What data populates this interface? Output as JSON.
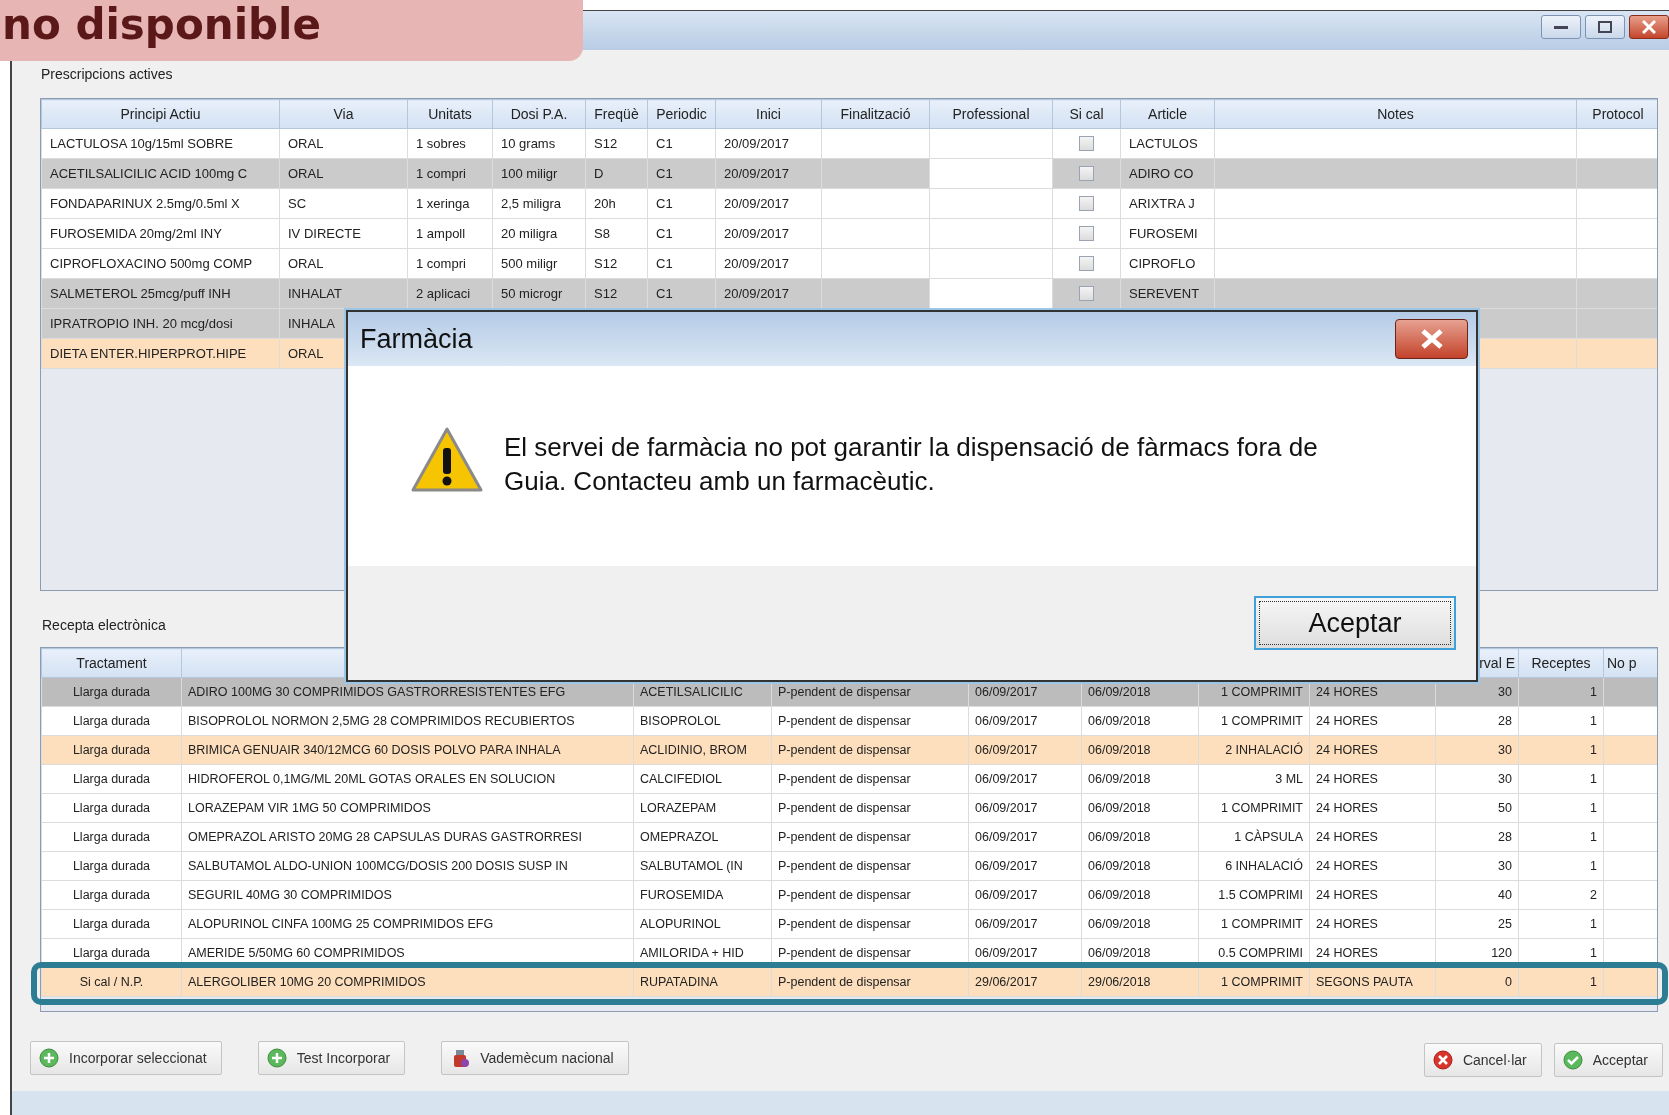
{
  "annotation_label": "no disponible",
  "prescriptions": {
    "title": "Prescripcions actives",
    "columns": [
      "Principi Actiu",
      "Via",
      "Unitats",
      "Dosi P.A.",
      "Freqüè",
      "Periodic",
      "Inici",
      "Finalització",
      "Professional",
      "Si cal",
      "Article",
      "Notes",
      "Protocol"
    ],
    "rows": [
      {
        "cells": [
          "LACTULOSA 10g/15ml SOBRE",
          "ORAL",
          "1 sobres",
          "10 grams",
          "S12",
          "C1",
          "20/09/2017"
        ],
        "si_cal": false,
        "article": "LACTULOS",
        "greyed": false,
        "highlighted": false
      },
      {
        "cells": [
          "ACETILSALICILIC ACID 100mg C",
          "ORAL",
          "1 compri",
          "100 miligr",
          "D",
          "C1",
          "20/09/2017"
        ],
        "si_cal": false,
        "article": "ADIRO CO",
        "greyed": true,
        "highlighted": false
      },
      {
        "cells": [
          "FONDAPARINUX 2.5mg/0.5ml X",
          "SC",
          "1 xeringa",
          "2,5 miligra",
          "20h",
          "C1",
          "20/09/2017"
        ],
        "si_cal": false,
        "article": "ARIXTRA J",
        "greyed": false,
        "highlighted": false
      },
      {
        "cells": [
          "FUROSEMIDA 20mg/2ml INY",
          "IV DIRECTE",
          "1 ampoll",
          "20 miligra",
          "S8",
          "C1",
          "20/09/2017"
        ],
        "si_cal": false,
        "article": "FUROSEMI",
        "greyed": false,
        "highlighted": false
      },
      {
        "cells": [
          "CIPROFLOXACINO 500mg COMP",
          "ORAL",
          "1 compri",
          "500 miligr",
          "S12",
          "C1",
          "20/09/2017"
        ],
        "si_cal": false,
        "article": "CIPROFLO",
        "greyed": false,
        "highlighted": false
      },
      {
        "cells": [
          "SALMETEROL 25mcg/puff INH",
          "INHALAT",
          "2 aplicaci",
          "50 microgr",
          "S12",
          "C1",
          "20/09/2017"
        ],
        "si_cal": false,
        "article": "SEREVENT",
        "greyed": true,
        "highlighted": false
      },
      {
        "cells": [
          "IPRATROPIO INH. 20 mcg/dosi",
          "INHALA"
        ],
        "greyed": true,
        "highlighted": false
      },
      {
        "cells": [
          "DIETA ENTER.HIPERPROT.HIPE",
          "ORAL"
        ],
        "greyed": false,
        "highlighted": true
      }
    ]
  },
  "prescription_e": {
    "title": "Recepta electrònica",
    "columns": [
      "Tractament",
      null,
      null,
      null,
      null,
      null,
      null,
      null,
      "rval E",
      "Receptes",
      "No p"
    ],
    "rows": [
      {
        "cells": [
          "Llarga durada",
          "ADIRO 100MG 30 COMPRIMIDOS GASTRORRESISTENTES EFG",
          "ACETILSALICILIC",
          "P-pendent de dispensar",
          "06/09/2017",
          "06/09/2018",
          "1 COMPRIMIT",
          "24 HORES",
          "30",
          "1"
        ],
        "greyed": true,
        "highlighted": false
      },
      {
        "cells": [
          "Llarga durada",
          "BISOPROLOL NORMON 2,5MG 28 COMPRIMIDOS RECUBIERTOS",
          "BISOPROLOL",
          "P-pendent de dispensar",
          "06/09/2017",
          "06/09/2018",
          "1 COMPRIMIT",
          "24 HORES",
          "28",
          "1"
        ],
        "greyed": false,
        "highlighted": false
      },
      {
        "cells": [
          "Llarga durada",
          "BRIMICA GENUAIR 340/12MCG 60 DOSIS POLVO PARA INHALA",
          "ACLIDINIO, BROM",
          "P-pendent de dispensar",
          "06/09/2017",
          "06/09/2018",
          "2 INHALACIÓ",
          "24 HORES",
          "30",
          "1"
        ],
        "greyed": false,
        "highlighted": true
      },
      {
        "cells": [
          "Llarga durada",
          "HIDROFEROL 0,1MG/ML 20ML GOTAS ORALES EN SOLUCION",
          "CALCIFEDIOL",
          "P-pendent de dispensar",
          "06/09/2017",
          "06/09/2018",
          "3 ML",
          "24 HORES",
          "30",
          "1"
        ],
        "greyed": false,
        "highlighted": false
      },
      {
        "cells": [
          "Llarga durada",
          "LORAZEPAM VIR 1MG 50 COMPRIMIDOS",
          "LORAZEPAM",
          "P-pendent de dispensar",
          "06/09/2017",
          "06/09/2018",
          "1 COMPRIMIT",
          "24 HORES",
          "50",
          "1"
        ],
        "greyed": false,
        "highlighted": false
      },
      {
        "cells": [
          "Llarga durada",
          "OMEPRAZOL ARISTO 20MG 28 CAPSULAS DURAS GASTRORRESI",
          "OMEPRAZOL",
          "P-pendent de dispensar",
          "06/09/2017",
          "06/09/2018",
          "1 CÀPSULA",
          "24 HORES",
          "28",
          "1"
        ],
        "greyed": false,
        "highlighted": false
      },
      {
        "cells": [
          "Llarga durada",
          "SALBUTAMOL ALDO-UNION 100MCG/DOSIS 200 DOSIS SUSP IN",
          "SALBUTAMOL (IN",
          "P-pendent de dispensar",
          "06/09/2017",
          "06/09/2018",
          "6 INHALACIÓ",
          "24 HORES",
          "30",
          "1"
        ],
        "greyed": false,
        "highlighted": false
      },
      {
        "cells": [
          "Llarga durada",
          "SEGURIL 40MG 30 COMPRIMIDOS",
          "FUROSEMIDA",
          "P-pendent de dispensar",
          "06/09/2017",
          "06/09/2018",
          "1.5 COMPRIMI",
          "24 HORES",
          "40",
          "2"
        ],
        "greyed": false,
        "highlighted": false
      },
      {
        "cells": [
          "Llarga durada",
          "ALOPURINOL CINFA 100MG 25 COMPRIMIDOS EFG",
          "ALOPURINOL",
          "P-pendent de dispensar",
          "06/09/2017",
          "06/09/2018",
          "1 COMPRIMIT",
          "24 HORES",
          "25",
          "1"
        ],
        "greyed": false,
        "highlighted": false
      },
      {
        "cells": [
          "Llarga durada",
          "AMERIDE 5/50MG 60 COMPRIMIDOS",
          "AMILORIDA + HID",
          "P-pendent de dispensar",
          "06/09/2017",
          "06/09/2018",
          "0.5 COMPRIMI",
          "24 HORES",
          "120",
          "1"
        ],
        "greyed": false,
        "highlighted": false
      },
      {
        "cells": [
          "Si cal / N.P.",
          "ALERGOLIBER 10MG 20 COMPRIMIDOS",
          "RUPATADINA",
          "P-pendent de dispensar",
          "29/06/2017",
          "29/06/2018",
          "1 COMPRIMIT",
          "SEGONS PAUTA",
          "0",
          "1"
        ],
        "greyed": false,
        "highlighted": true
      }
    ]
  },
  "left_buttons": [
    {
      "label": "Incorporar seleccionat",
      "kind": "add"
    },
    {
      "label": "Test Incorporar",
      "kind": "add"
    },
    {
      "label": "Vademècum nacional",
      "kind": "bottle"
    }
  ],
  "right_buttons": [
    {
      "label": "Cancel·lar",
      "kind": "cancel"
    },
    {
      "label": "Acceptar",
      "kind": "ok"
    }
  ],
  "dialog": {
    "title": "Farmàcia",
    "message": "El servei de farmàcia no pot garantir la dispensació de fàrmacs fora de Guia. Contacteu amb un farmacèutic.",
    "button": "Aceptar"
  }
}
